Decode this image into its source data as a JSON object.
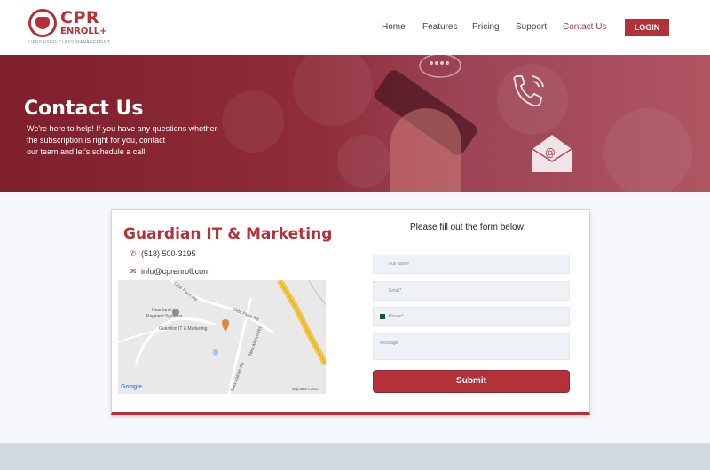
{
  "logo": {
    "name": "CPR",
    "sub": "ENROLL+",
    "tagline": "LIFESAVING CLASS MANAGEMENT"
  },
  "nav": [
    {
      "label": "Home"
    },
    {
      "label": "Features"
    },
    {
      "label": "Pricing"
    },
    {
      "label": "Support"
    },
    {
      "label": "Contact Us",
      "active": true
    }
  ],
  "login_label": "LOGIN",
  "hero": {
    "title": "Contact Us",
    "lines": [
      "We're here to help! If you have any questions whether",
      "the subscription is right for you, contact",
      "our team and let's schedule a call."
    ]
  },
  "company": {
    "name": "Guardian IT & Marketing",
    "phone": "(518) 500-3195",
    "email": "info@cprenroll.com"
  },
  "map": {
    "labels": [
      "Heartland",
      "Payment Systems",
      "Guardian IT & Marketing",
      "Olde Farm Rd",
      "Olde Farm Rd",
      "New Aldrich Rd",
      "New Aldrich Rd"
    ],
    "google": "Google",
    "map_data": "Map data ©2022"
  },
  "form": {
    "title": "Please fill out the form below:",
    "full_name": "Full Name",
    "email": "Email*",
    "phone": "Phone*",
    "message": "Message",
    "submit": "Submit"
  },
  "colors": {
    "brand": "#b3323a",
    "hero": "#8f2d3a"
  }
}
